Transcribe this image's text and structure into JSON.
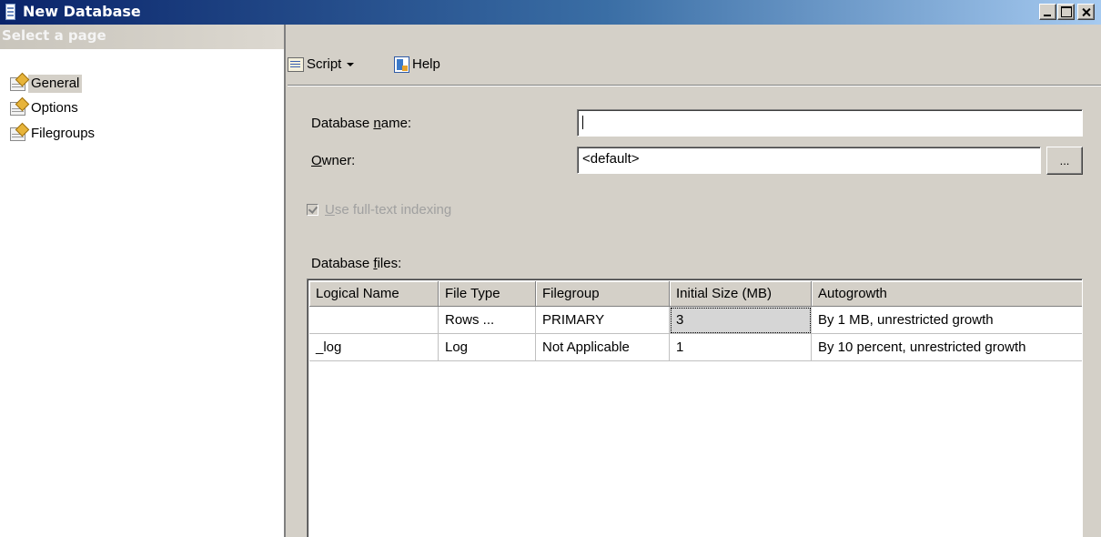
{
  "window": {
    "title": "New Database"
  },
  "left_pane": {
    "header": "Select a page",
    "items": [
      {
        "label": "General",
        "selected": true
      },
      {
        "label": "Options",
        "selected": false
      },
      {
        "label": "Filegroups",
        "selected": false
      }
    ]
  },
  "toolbar": {
    "script_label": "Script",
    "help_label": "Help"
  },
  "form": {
    "db_name_prefix": "Database ",
    "db_name_key": "n",
    "db_name_suffix": "ame:",
    "db_name_value": "",
    "owner_key": "O",
    "owner_suffix": "wner:",
    "owner_value": "<default>",
    "browse_label": "...",
    "fulltext_key": "U",
    "fulltext_suffix": "se full-text indexing",
    "fulltext_checked": true,
    "fulltext_enabled": false,
    "files_prefix": "Database ",
    "files_key": "f",
    "files_suffix": "iles:"
  },
  "grid": {
    "columns": [
      "Logical Name",
      "File Type",
      "Filegroup",
      "Initial Size (MB)",
      "Autogrowth"
    ],
    "rows": [
      [
        "",
        "Rows ...",
        "PRIMARY",
        "3",
        "By 1 MB, unrestricted growth"
      ],
      [
        "_log",
        "Log",
        "Not Applicable",
        "1",
        "By 10 percent, unrestricted growth"
      ]
    ]
  }
}
